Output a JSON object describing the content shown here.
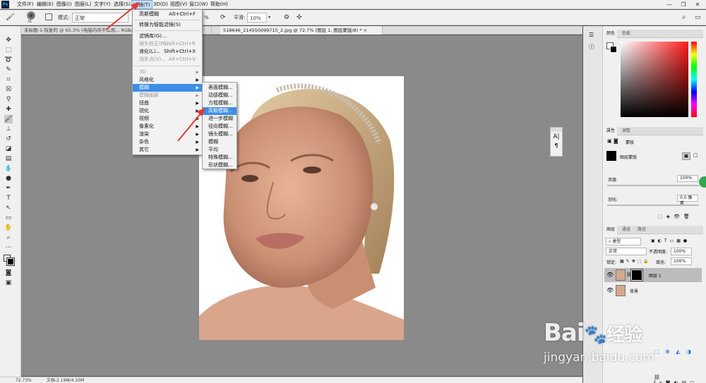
{
  "menubar": {
    "logo": "Ps",
    "items": [
      "文件(F)",
      "编辑(E)",
      "图像(I)",
      "图层(L)",
      "文字(Y)",
      "选择(S)",
      "滤镜(T)",
      "3D(D)",
      "视图(V)",
      "窗口(W)",
      "帮助(H)"
    ],
    "window_controls": [
      "—",
      "❐",
      "✕"
    ]
  },
  "options": {
    "brush_size": "31",
    "mode_label": "模式:",
    "mode_value": "正常",
    "opacity_value": "%",
    "smooth_label": "平滑:",
    "smooth_value": "10%"
  },
  "tabs": [
    {
      "label": "未标题-1-恢复的 @ 65.3% (电脑内存不么用... RGB/8) *",
      "close": "×"
    },
    {
      "label": "518646_214550099715_2.jpg @ 72.7% (图层 1, 图层蒙版/8) *",
      "close": "×"
    }
  ],
  "filter_menu": {
    "items": [
      {
        "label": "高斯模糊",
        "shortcut": "Alt+Ctrl+F"
      },
      {
        "label": "转换为智能滤镜(S)"
      },
      {
        "label": "滤镜库(G)..."
      },
      {
        "label": "镜头校正(R)...",
        "shortcut": "Shift+Ctrl+R",
        "disabled": true
      },
      {
        "label": "液化(L)...",
        "shortcut": "Shift+Ctrl+X"
      },
      {
        "label": "消失点(V)...",
        "shortcut": "Alt+Ctrl+V",
        "disabled": true
      },
      {
        "label": "3D",
        "disabled": true
      },
      {
        "label": "风格化"
      },
      {
        "label": "模糊"
      },
      {
        "label": "模糊画廊",
        "disabled": true
      },
      {
        "label": "扭曲"
      },
      {
        "label": "锐化"
      },
      {
        "label": "视频"
      },
      {
        "label": "像素化"
      },
      {
        "label": "渲染"
      },
      {
        "label": "杂色"
      },
      {
        "label": "其它"
      }
    ]
  },
  "blur_submenu": {
    "items": [
      "表面模糊...",
      "动感模糊...",
      "方框模糊...",
      "高斯模糊...",
      "进一步模糊",
      "径向模糊...",
      "镜头模糊...",
      "模糊",
      "平均",
      "特殊模糊...",
      "形状模糊..."
    ]
  },
  "status": {
    "zoom": "72.73%",
    "doc_info": "文档:2.19M/4.33M"
  },
  "color_panel": {
    "tabs": [
      "颜色",
      "色板"
    ]
  },
  "properties_panel": {
    "tabs": [
      "属性",
      "调整"
    ],
    "title": "蒙版",
    "layer_mask_label": "图层蒙版",
    "density_label": "浓度:",
    "density_value": "100%",
    "feather_label": "羽化:",
    "feather_value": "0.0 像素"
  },
  "layers_panel": {
    "tabs": [
      "图层",
      "通道",
      "路径"
    ],
    "filter_kind": "类型",
    "blend_mode": "正常",
    "opacity_label": "不透明度:",
    "opacity_value": "100%",
    "lock_label": "锁定:",
    "fill_label": "填充:",
    "fill_value": "100%",
    "layers": [
      {
        "name": "图层 1",
        "selected": true
      },
      {
        "name": "背景",
        "selected": false
      }
    ]
  },
  "watermark": {
    "brand": "Bai",
    "brand_suffix": "经验",
    "url": "jingyan.baidu.com"
  },
  "colors": {
    "accent": "#3d8ee6",
    "arrow": "#e53935",
    "menu_bg": "#f2f2f2",
    "canvas": "#8a8a8a"
  }
}
